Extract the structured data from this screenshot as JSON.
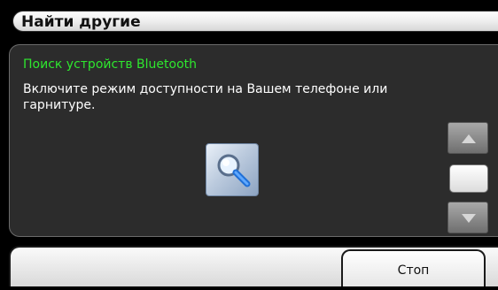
{
  "header": {
    "title": "Найти другие"
  },
  "search": {
    "status": "Поиск устройств Bluetooth",
    "message": "Включите режим доступности на Вашем телефоне или гарнитуре.",
    "icon": "magnifier-icon"
  },
  "scrollbar": {
    "up_icon": "arrow-up-icon",
    "down_icon": "arrow-down-icon"
  },
  "footer": {
    "stop_label": "Стоп"
  },
  "colors": {
    "background": "#000000",
    "panel": "#2c2c2c",
    "status_text": "#2ee62e",
    "message_text": "#ffffff"
  }
}
